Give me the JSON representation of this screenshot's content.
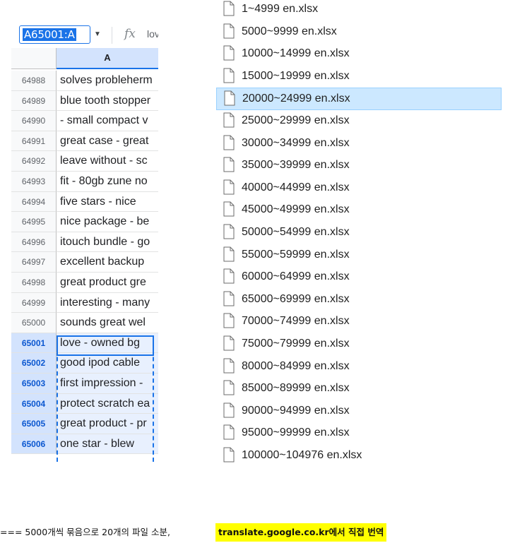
{
  "sheet": {
    "name_box": "A65001:A",
    "fx_label": "fx",
    "formula_value": "lov",
    "column_header": "A",
    "rows": [
      {
        "num": "64988",
        "value": "solves probleherm",
        "selected": false
      },
      {
        "num": "64989",
        "value": "blue tooth stopper",
        "selected": false
      },
      {
        "num": "64990",
        "value": "- small compact v",
        "selected": false
      },
      {
        "num": "64991",
        "value": "great case - great",
        "selected": false
      },
      {
        "num": "64992",
        "value": "leave without - sc",
        "selected": false
      },
      {
        "num": "64993",
        "value": "fit - 80gb zune no",
        "selected": false
      },
      {
        "num": "64994",
        "value": "five stars - nice",
        "selected": false
      },
      {
        "num": "64995",
        "value": "nice package - be",
        "selected": false
      },
      {
        "num": "64996",
        "value": "itouch bundle - go",
        "selected": false
      },
      {
        "num": "64997",
        "value": "excellent backup",
        "selected": false
      },
      {
        "num": "64998",
        "value": "great product gre",
        "selected": false
      },
      {
        "num": "64999",
        "value": "interesting - many",
        "selected": false
      },
      {
        "num": "65000",
        "value": "sounds great wel",
        "selected": false
      },
      {
        "num": "65001",
        "value": "love - owned bg",
        "selected": true
      },
      {
        "num": "65002",
        "value": "good ipod cable",
        "selected": true
      },
      {
        "num": "65003",
        "value": "first impression -",
        "selected": true
      },
      {
        "num": "65004",
        "value": "protect scratch ea",
        "selected": true
      },
      {
        "num": "65005",
        "value": "great product - pr",
        "selected": true
      },
      {
        "num": "65006",
        "value": "one star - blew",
        "selected": true
      }
    ]
  },
  "files": [
    {
      "name": "1~4999 en.xlsx",
      "selected": false
    },
    {
      "name": "5000~9999 en.xlsx",
      "selected": false
    },
    {
      "name": "10000~14999 en.xlsx",
      "selected": false
    },
    {
      "name": "15000~19999 en.xlsx",
      "selected": false
    },
    {
      "name": "20000~24999 en.xlsx",
      "selected": true
    },
    {
      "name": "25000~29999 en.xlsx",
      "selected": false
    },
    {
      "name": "30000~34999 en.xlsx",
      "selected": false
    },
    {
      "name": "35000~39999 en.xlsx",
      "selected": false
    },
    {
      "name": "40000~44999 en.xlsx",
      "selected": false
    },
    {
      "name": "45000~49999 en.xlsx",
      "selected": false
    },
    {
      "name": "50000~54999 en.xlsx",
      "selected": false
    },
    {
      "name": "55000~59999 en.xlsx",
      "selected": false
    },
    {
      "name": "60000~64999 en.xlsx",
      "selected": false
    },
    {
      "name": "65000~69999 en.xlsx",
      "selected": false
    },
    {
      "name": "70000~74999 en.xlsx",
      "selected": false
    },
    {
      "name": "75000~79999 en.xlsx",
      "selected": false
    },
    {
      "name": "80000~84999 en.xlsx",
      "selected": false
    },
    {
      "name": "85000~89999 en.xlsx",
      "selected": false
    },
    {
      "name": "90000~94999 en.xlsx",
      "selected": false
    },
    {
      "name": "95000~99999 en.xlsx",
      "selected": false
    },
    {
      "name": "100000~104976 en.xlsx",
      "selected": false
    }
  ],
  "caption": {
    "text": "=== 5000개씩 묶음으로 20개의 파일 소분,",
    "highlight": "translate.google.co.kr에서 직접 번역"
  },
  "colors": {
    "accent": "#1a73e8",
    "file_selected_bg": "#cce8ff",
    "highlight": "#ffff00"
  }
}
